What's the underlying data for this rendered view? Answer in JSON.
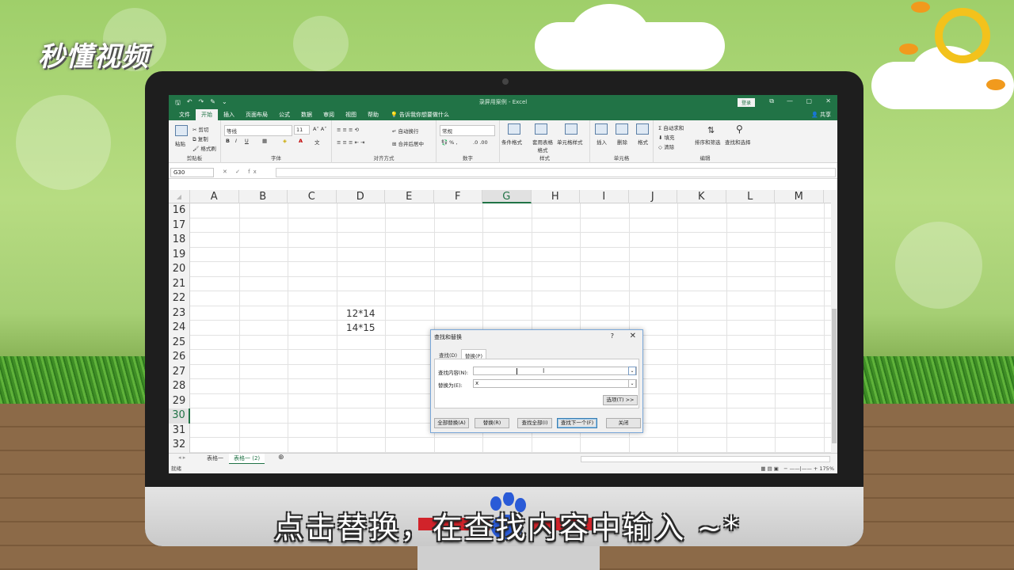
{
  "branding": {
    "logo_text": "秒懂视频"
  },
  "excel": {
    "quick_access": [
      "🖫",
      "↶",
      "↷",
      "✎",
      "⌄"
    ],
    "window_title": "录屏用案例 - Excel",
    "login_label": "登录",
    "window_controls": [
      "⧉",
      "—",
      "▢",
      "✕"
    ],
    "ribbon_tabs": [
      "文件",
      "开始",
      "插入",
      "页面布局",
      "公式",
      "数据",
      "审阅",
      "视图",
      "帮助"
    ],
    "active_tab": "开始",
    "tell_me": "告诉我你想要做什么",
    "share": "共享",
    "ribbon": {
      "clipboard": {
        "paste": "粘贴",
        "cut": "剪切",
        "copy": "复制",
        "format_painter": "格式刷",
        "label": "剪贴板"
      },
      "font": {
        "font_name": "等线",
        "font_size": "11",
        "label": "字体",
        "bold": "B",
        "italic": "I",
        "underline": "U"
      },
      "alignment": {
        "wrap": "自动换行",
        "merge": "合并后居中",
        "label": "对齐方式"
      },
      "number": {
        "format": "常规",
        "label": "数字"
      },
      "styles": {
        "conditional": "条件格式",
        "table": "套用表格格式",
        "cell_styles": "单元格样式",
        "label": "样式"
      },
      "cells": {
        "insert": "插入",
        "delete": "删除",
        "format": "格式",
        "label": "单元格"
      },
      "editing": {
        "autosum": "自动求和",
        "fill": "填充",
        "clear": "清除",
        "sort": "排序和筛选",
        "find": "查找和选择",
        "label": "编辑"
      }
    },
    "name_box": "G30",
    "fx_symbols": "✕ ✓ fx",
    "columns": [
      "A",
      "B",
      "C",
      "D",
      "E",
      "F",
      "G",
      "H",
      "I",
      "J",
      "K",
      "L",
      "M"
    ],
    "selected_column": "G",
    "rows": [
      "16",
      "17",
      "18",
      "19",
      "20",
      "21",
      "22",
      "23",
      "24",
      "25",
      "26",
      "27",
      "28",
      "29",
      "30",
      "31",
      "32"
    ],
    "selected_row": "30",
    "cells": {
      "D23": "12*14",
      "D24": "14*15"
    },
    "sheet_tabs": [
      "表格一",
      "表格一 (2)"
    ],
    "active_sheet": "表格一 (2)",
    "status": "就绪",
    "zoom": "175%",
    "dialog": {
      "title": "查找和替换",
      "help": "?",
      "close": "✕",
      "tabs": [
        "查找(D)",
        "替换(P)"
      ],
      "active_tab": "替换(P)",
      "find_label": "查找内容(N):",
      "find_value": "",
      "replace_label": "替换为(E):",
      "replace_value": "x",
      "options_btn": "选项(T) >>",
      "buttons": [
        "全部替换(A)",
        "替换(R)",
        "查找全部(I)",
        "查找下一个(F)",
        "关闭"
      ]
    }
  },
  "subtitle": "点击替换，在查找内容中输入 ~*"
}
